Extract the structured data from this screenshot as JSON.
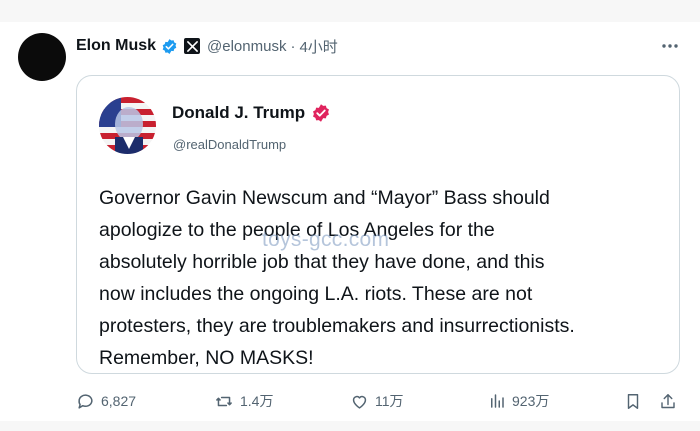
{
  "post": {
    "author_name": "Elon Musk",
    "handle": "@elonmusk",
    "separator": "·",
    "time": "4小时"
  },
  "quote": {
    "author_name": "Donald J. Trump",
    "handle": "@realDonaldTrump",
    "text_lines": [
      "Governor Gavin Newscum and “Mayor” Bass should",
      "apologize to the people of Los Angeles for the",
      "absolutely horrible job that they have done, and this",
      "now includes the ongoing L.A. riots. These are not",
      "protesters, they are troublemakers and insurrectionists.",
      "Remember, NO MASKS!"
    ]
  },
  "watermark": "toys-gcc.com",
  "actions": {
    "replies": "6,827",
    "reposts": "1.4万",
    "likes": "11万",
    "views": "923万"
  },
  "colors": {
    "verified_blue": "#1d9bf0",
    "verified_pink": "#e0245e",
    "secondary_text": "#536471",
    "border": "#cfd9de"
  },
  "icons": [
    "verified-icon",
    "x-logo-icon",
    "more-icon",
    "reply-icon",
    "repost-icon",
    "like-icon",
    "views-icon",
    "bookmark-icon",
    "share-icon"
  ]
}
